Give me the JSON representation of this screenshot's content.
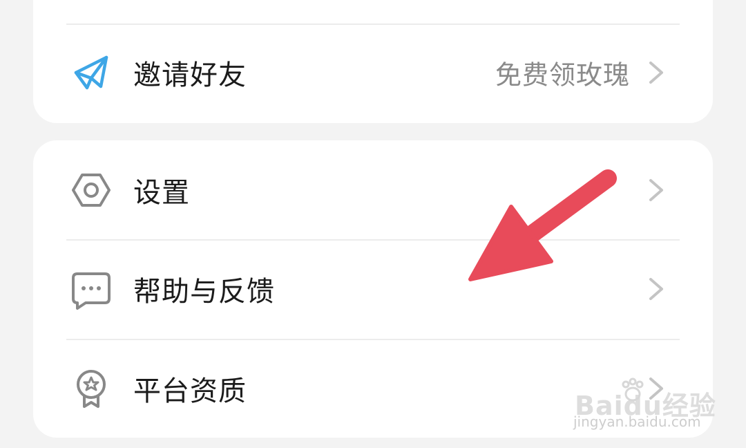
{
  "menu_top": {
    "invite": {
      "label": "邀请好友",
      "value": "免费领玫瑰",
      "icon": "paper-plane-icon",
      "icon_color": "#3ea6e6"
    }
  },
  "menu_bottom": {
    "settings": {
      "label": "设置",
      "icon": "settings-hexagon-icon"
    },
    "help": {
      "label": "帮助与反馈",
      "icon": "chat-bubble-icon"
    },
    "qualification": {
      "label": "平台资质",
      "icon": "award-badge-icon"
    }
  },
  "overlay": {
    "arrow_color": "#e84b5a"
  },
  "watermark": {
    "main": "Baidu经验",
    "url": "jingyan.baidu.com"
  }
}
